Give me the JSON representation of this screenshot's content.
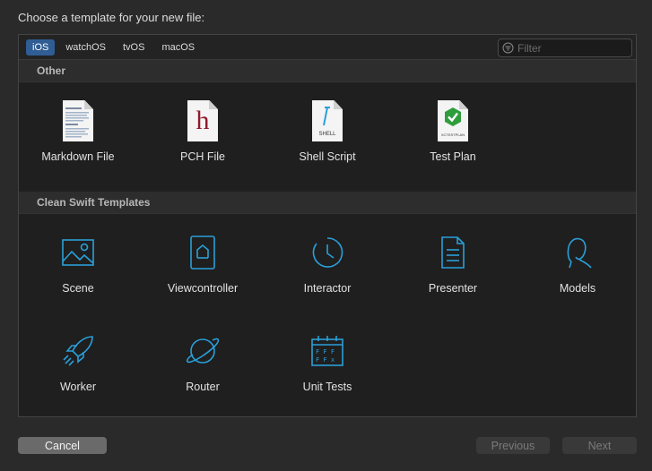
{
  "header": {
    "title": "Choose a template for your new file:"
  },
  "platform_tabs": [
    {
      "label": "iOS",
      "selected": true
    },
    {
      "label": "watchOS",
      "selected": false
    },
    {
      "label": "tvOS",
      "selected": false
    },
    {
      "label": "macOS",
      "selected": false
    }
  ],
  "filter": {
    "placeholder": "Filter",
    "value": "",
    "icon": "filter-icon"
  },
  "sections": {
    "other": {
      "title": "Other",
      "items": [
        {
          "label": "Markdown File",
          "icon": "markdown-file-icon"
        },
        {
          "label": "PCH File",
          "icon": "pch-file-icon",
          "glyph": "h"
        },
        {
          "label": "Shell Script",
          "icon": "shell-script-icon",
          "glyph": "SHELL"
        },
        {
          "label": "Test Plan",
          "icon": "test-plan-icon",
          "glyph": "XCTESTPLAN"
        }
      ]
    },
    "clean_swift": {
      "title": "Clean Swift Templates",
      "items": [
        {
          "label": "Scene",
          "icon": "scene-icon"
        },
        {
          "label": "Viewcontroller",
          "icon": "viewcontroller-icon"
        },
        {
          "label": "Interactor",
          "icon": "interactor-icon"
        },
        {
          "label": "Presenter",
          "icon": "presenter-icon"
        },
        {
          "label": "Models",
          "icon": "models-icon"
        },
        {
          "label": "Worker",
          "icon": "worker-icon"
        },
        {
          "label": "Router",
          "icon": "router-icon"
        },
        {
          "label": "Unit Tests",
          "icon": "unit-tests-icon"
        }
      ]
    }
  },
  "buttons": {
    "cancel": "Cancel",
    "previous": "Previous",
    "next": "Next"
  },
  "colors": {
    "accent": "#2f5d94",
    "icon_blue": "#2a9fd8",
    "pch_red": "#8e1b2b",
    "testplan_green": "#2e9e3c"
  }
}
